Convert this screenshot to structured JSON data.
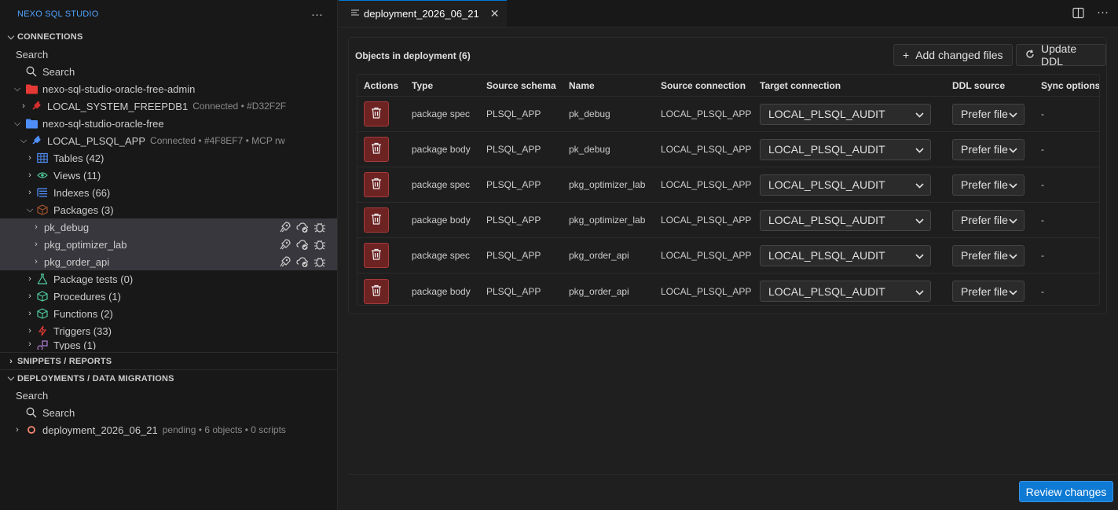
{
  "sidebar": {
    "title": "NEXO SQL STUDIO",
    "more_label": "···",
    "connections": {
      "header": "CONNECTIONS",
      "search_label": "Search",
      "search_button": "Search",
      "groups": [
        {
          "label": "nexo-sql-studio-oracle-free-admin",
          "folder_color": "#e53935"
        },
        {
          "label": "nexo-sql-studio-oracle-free",
          "folder_color": "#4f8ef7"
        }
      ],
      "conn_system": {
        "label": "LOCAL_SYSTEM_FREEPDB1",
        "meta": "Connected • #D32F2F",
        "color": "#d32f2f"
      },
      "conn_plsql": {
        "label": "LOCAL_PLSQL_APP",
        "meta": "Connected • #4F8EF7 • MCP rw",
        "color": "#4f8ef7"
      },
      "categories": {
        "tables": "Tables (42)",
        "views": "Views (11)",
        "indexes": "Indexes (66)",
        "packages": "Packages (3)",
        "package_tests": "Package tests (0)",
        "procedures": "Procedures (1)",
        "functions": "Functions (2)",
        "triggers": "Triggers (33)",
        "types": "Types (1)"
      },
      "packages": [
        "pk_debug",
        "pkg_optimizer_lab",
        "pkg_order_api"
      ]
    },
    "snippets_header": "SNIPPETS / REPORTS",
    "deployments": {
      "header": "DEPLOYMENTS / DATA MIGRATIONS",
      "search_label": "Search",
      "search_button": "Search",
      "item": {
        "label": "deployment_2026_06_21",
        "meta": "pending • 6 objects • 0 scripts"
      }
    }
  },
  "editor": {
    "tab_label": "deployment_2026_06_21",
    "panel_title": "Objects in deployment (6)",
    "add_button": "Add changed files",
    "update_button": "Update DDL",
    "columns": [
      "Actions",
      "Type",
      "Source schema",
      "Name",
      "Source connection",
      "Target connection",
      "DDL source",
      "Sync options"
    ],
    "rows": [
      {
        "type": "package spec",
        "schema": "PLSQL_APP",
        "name": "pk_debug",
        "src_conn": "LOCAL_PLSQL_APP",
        "target": "LOCAL_PLSQL_AUDIT",
        "ddl": "Prefer file",
        "sync": "-"
      },
      {
        "type": "package body",
        "schema": "PLSQL_APP",
        "name": "pk_debug",
        "src_conn": "LOCAL_PLSQL_APP",
        "target": "LOCAL_PLSQL_AUDIT",
        "ddl": "Prefer file",
        "sync": "-"
      },
      {
        "type": "package spec",
        "schema": "PLSQL_APP",
        "name": "pkg_optimizer_lab",
        "src_conn": "LOCAL_PLSQL_APP",
        "target": "LOCAL_PLSQL_AUDIT",
        "ddl": "Prefer file",
        "sync": "-"
      },
      {
        "type": "package body",
        "schema": "PLSQL_APP",
        "name": "pkg_optimizer_lab",
        "src_conn": "LOCAL_PLSQL_APP",
        "target": "LOCAL_PLSQL_AUDIT",
        "ddl": "Prefer file",
        "sync": "-"
      },
      {
        "type": "package spec",
        "schema": "PLSQL_APP",
        "name": "pkg_order_api",
        "src_conn": "LOCAL_PLSQL_APP",
        "target": "LOCAL_PLSQL_AUDIT",
        "ddl": "Prefer file",
        "sync": "-"
      },
      {
        "type": "package body",
        "schema": "PLSQL_APP",
        "name": "pkg_order_api",
        "src_conn": "LOCAL_PLSQL_APP",
        "target": "LOCAL_PLSQL_AUDIT",
        "ddl": "Prefer file",
        "sync": "-"
      }
    ],
    "review_button": "Review changes"
  }
}
